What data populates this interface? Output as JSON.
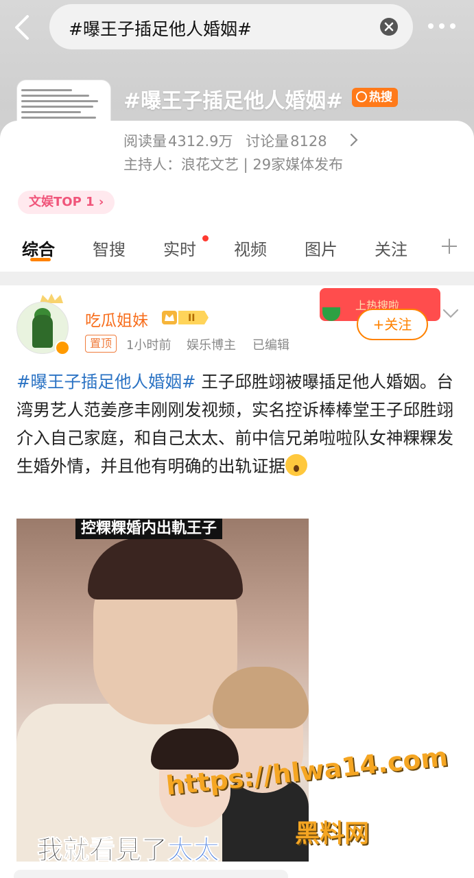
{
  "search": {
    "query": "#曝王子插足他人婚姻#"
  },
  "topic": {
    "title": "#曝王子插足他人婚姻#",
    "hot_badge": "热搜",
    "reads_label": "阅读量",
    "reads_value": "4312.9万",
    "discussions_label": "讨论量",
    "discussions_value": "8128",
    "host_line": "主持人：浪花文艺 | 29家媒体发布",
    "rank_label": "文娱TOP 1"
  },
  "tabs": [
    {
      "label": "综合",
      "active": true
    },
    {
      "label": "智搜",
      "active": false
    },
    {
      "label": "实时",
      "active": false,
      "has_dot": true
    },
    {
      "label": "视频",
      "active": false
    },
    {
      "label": "图片",
      "active": false
    },
    {
      "label": "关注",
      "active": false
    }
  ],
  "post": {
    "author": "吃瓜姐妹",
    "vip_level": "II",
    "pin_tag": "置顶",
    "time": "1小时前",
    "role": "娱乐博主",
    "edited": "已编辑",
    "follow_label": "+关注",
    "promo_text": "上热搜啦",
    "hashtag": "#曝王子插足他人婚姻#",
    "body": " 王子邱胜翊被曝插足他人婚姻。台湾男艺人范姜彦丰刚刚发视频，实名控诉棒棒堂王子邱胜翊介入自己家庭，和自己太太、前中信兄弟啦啦队女神粿粿发生婚外情，并且他有明确的出轨证据",
    "image_caption_top": "控粿粿婚内出軌王子",
    "image_caption_bottom_a": "我就看見了",
    "image_caption_bottom_b": "太太"
  },
  "watermark": {
    "url": "https://hlwa14.com",
    "name": "黑料网"
  },
  "colors": {
    "accent": "#ff8200",
    "hashtag": "#2b73c4",
    "author": "#f76e1d",
    "hot_badge": "#ff7a1a",
    "rank_pill_text": "#f0557a"
  },
  "icons": [
    "back-arrow-icon",
    "clear-icon",
    "more-icon",
    "chevron-right-icon",
    "plus-icon",
    "chevron-down-icon",
    "verified-icon",
    "crown-icon"
  ]
}
